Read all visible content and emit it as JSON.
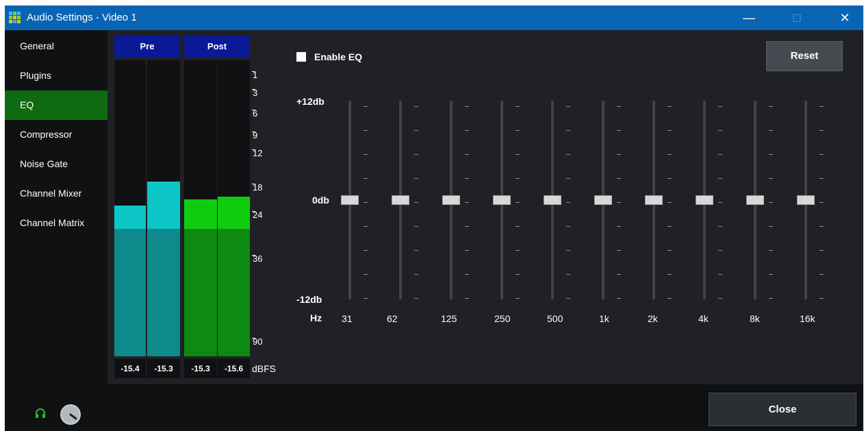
{
  "window": {
    "title": "Audio Settings - Video 1"
  },
  "window_controls": {
    "minimize": "—",
    "maximize": "□",
    "close": "✕"
  },
  "sidebar": {
    "items": [
      {
        "label": "General"
      },
      {
        "label": "Plugins"
      },
      {
        "label": "EQ",
        "active": true
      },
      {
        "label": "Compressor"
      },
      {
        "label": "Noise Gate"
      },
      {
        "label": "Channel Mixer"
      },
      {
        "label": "Channel Matrix"
      }
    ]
  },
  "meters": {
    "pre_label": "Pre",
    "post_label": "Post",
    "channels": [
      {
        "group": "pre",
        "value": "-15.4",
        "level_pct": 43,
        "peak_pct": 51
      },
      {
        "group": "pre",
        "value": "-15.3",
        "level_pct": 43,
        "peak_pct": 59
      },
      {
        "group": "post",
        "value": "-15.3",
        "level_pct": 43,
        "peak_pct": 53
      },
      {
        "group": "post",
        "value": "-15.6",
        "level_pct": 43,
        "peak_pct": 54
      }
    ],
    "scale": [
      "1",
      "3",
      "6",
      "9",
      "12",
      "18",
      "24",
      "36",
      "90"
    ],
    "unit": "dBFS",
    "colors": {
      "pre_level": "#0e8a8c",
      "pre_peak": "#0cc6c8",
      "post_level": "#0e8a10",
      "post_peak": "#10cc10"
    }
  },
  "eq": {
    "enable_label": "Enable EQ",
    "enabled": false,
    "reset_label": "Reset",
    "top_db": "+12db",
    "mid_db": "0db",
    "bottom_db": "-12db",
    "hz_label": "Hz",
    "bands": [
      {
        "freq": "31",
        "gain_db": 0
      },
      {
        "freq": "62",
        "gain_db": 0
      },
      {
        "freq": "125",
        "gain_db": 0
      },
      {
        "freq": "250",
        "gain_db": 0
      },
      {
        "freq": "500",
        "gain_db": 0
      },
      {
        "freq": "1k",
        "gain_db": 0
      },
      {
        "freq": "2k",
        "gain_db": 0
      },
      {
        "freq": "4k",
        "gain_db": 0
      },
      {
        "freq": "8k",
        "gain_db": 0
      },
      {
        "freq": "16k",
        "gain_db": 0
      }
    ]
  },
  "footer": {
    "close_label": "Close",
    "headphones_icon": "headphones-icon",
    "volume_knob_icon": "volume-knob-icon"
  },
  "colors": {
    "titlebar": "#0a64b4",
    "accent_active": "#0e6b10",
    "meter_header": "#0a1a96"
  }
}
